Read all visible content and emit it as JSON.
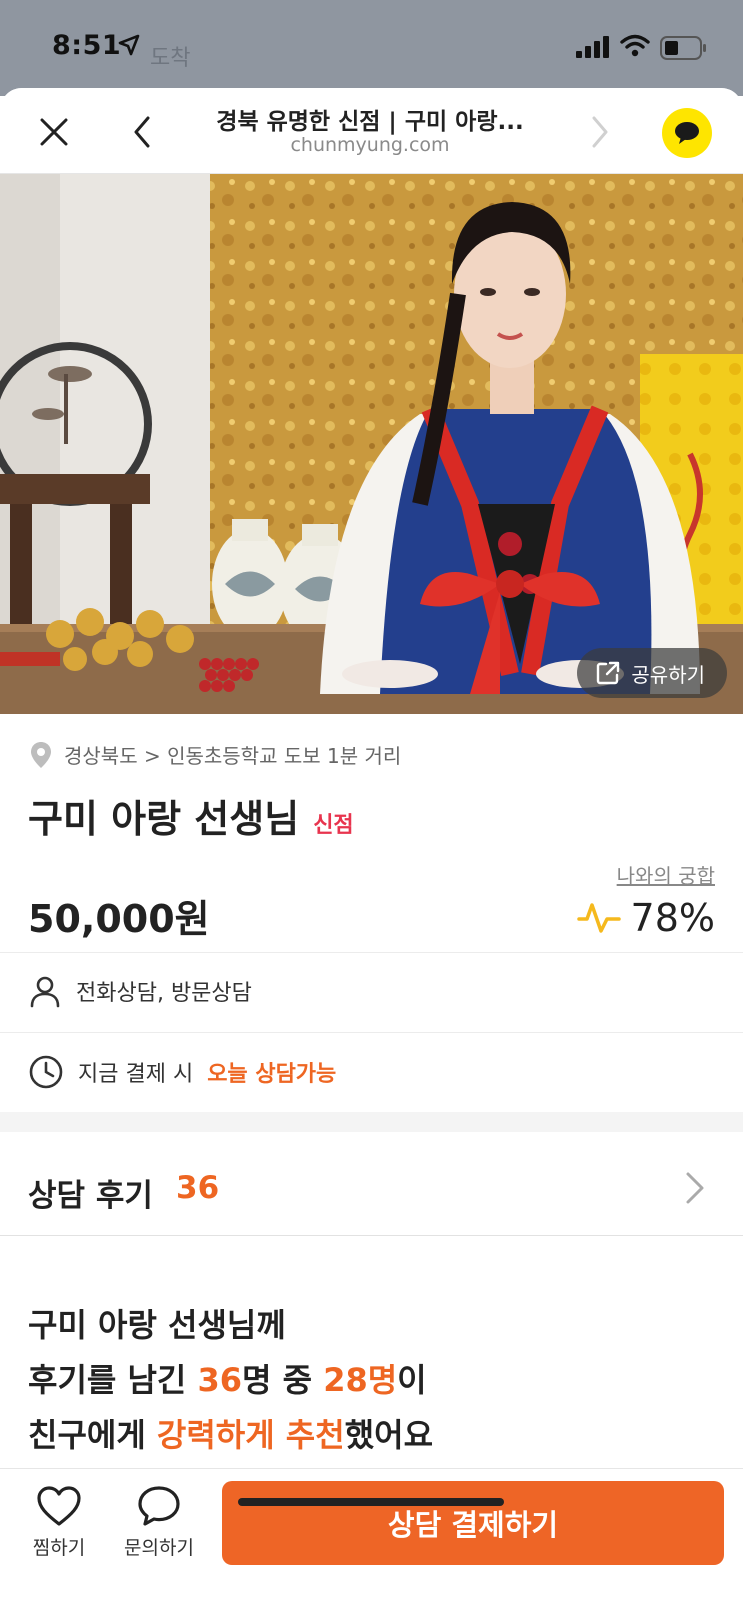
{
  "status": {
    "time": "8:51",
    "ghost_text": "도착"
  },
  "nav": {
    "title": "경북 유명한 신점 | 구미 아랑...",
    "domain": "chunmyung.com"
  },
  "hero": {
    "share_label": "공유하기"
  },
  "profile": {
    "location": "경상북도 > 인동초등학교 도보 1분 거리",
    "name": "구미 아랑 선생님",
    "badge": "신점",
    "price": "50,000원",
    "compat_link": "나와의 궁합",
    "compat_value": "78%"
  },
  "options": {
    "consult_types": "전화상담, 방문상담",
    "pay_prefix": "지금 결제 시",
    "pay_accent": "오늘 상담가능"
  },
  "reviews": {
    "label": "상담 후기",
    "count": "36"
  },
  "summary": {
    "line1": "구미 아랑 선생님께",
    "line2_a": "후기를 남긴 ",
    "line2_b": "36",
    "line2_c": "명 중 ",
    "line2_d": "28명",
    "line2_e": "이",
    "line3_a": "친구에게 ",
    "line3_b": "강력하게 추천",
    "line3_c": "했어요"
  },
  "bottom": {
    "like_label": "찜하기",
    "inquiry_label": "문의하기",
    "pay_button": "상담 결제하기"
  },
  "colors": {
    "accent": "#ee6526",
    "badge": "#e8344e",
    "kakao": "#FEE500"
  }
}
